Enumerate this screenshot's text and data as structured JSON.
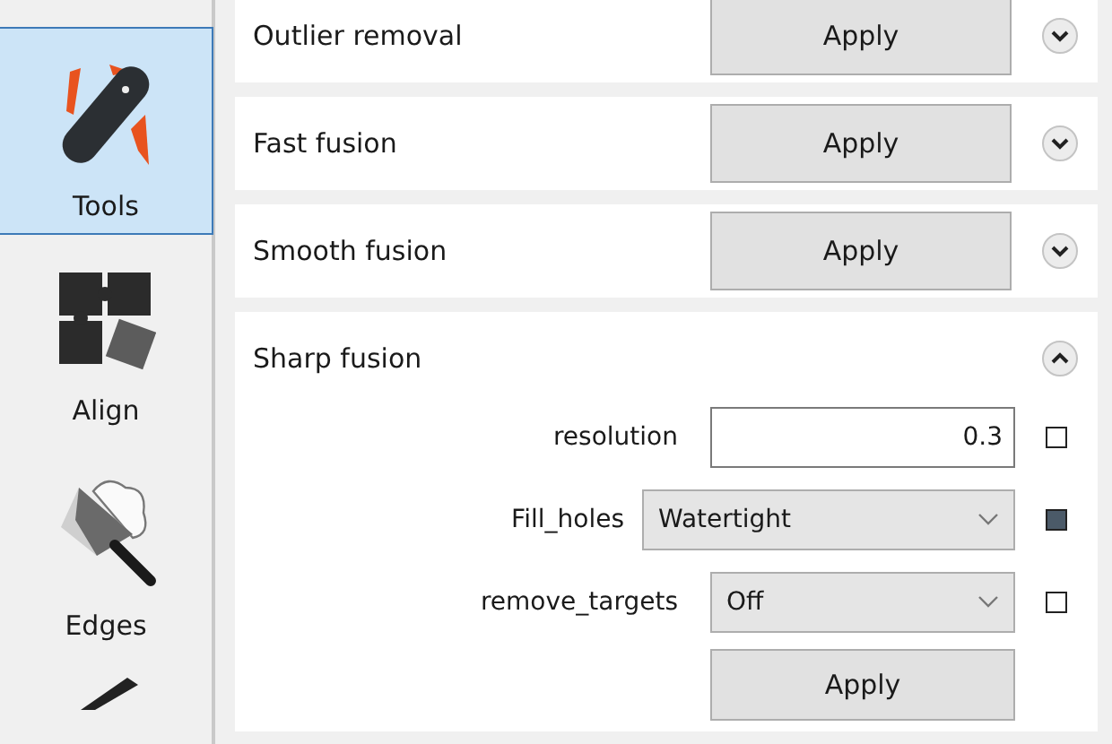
{
  "sidebar": {
    "items": [
      {
        "kind": "tools",
        "label": "Tools",
        "selected": true
      },
      {
        "kind": "align",
        "label": "Align",
        "selected": false
      },
      {
        "kind": "edges",
        "label": "Edges",
        "selected": false
      },
      {
        "kind": "brush",
        "selected": false
      }
    ]
  },
  "sections": [
    {
      "title": "Outlier removal",
      "expanded": false,
      "button": "Apply"
    },
    {
      "title": "Fast fusion",
      "expanded": false,
      "button": "Apply"
    },
    {
      "title": "Smooth fusion",
      "expanded": false,
      "button": "Apply"
    },
    {
      "title": "Sharp fusion",
      "expanded": true,
      "button": "Apply",
      "params": [
        {
          "kind": "text",
          "label": "resolution",
          "value": "0.3",
          "checked": false
        },
        {
          "kind": "select",
          "label": "Fill_holes",
          "value": "Watertight",
          "checked": true
        },
        {
          "kind": "select",
          "label": "remove_targets",
          "value": "Off",
          "checked": false
        }
      ]
    }
  ]
}
